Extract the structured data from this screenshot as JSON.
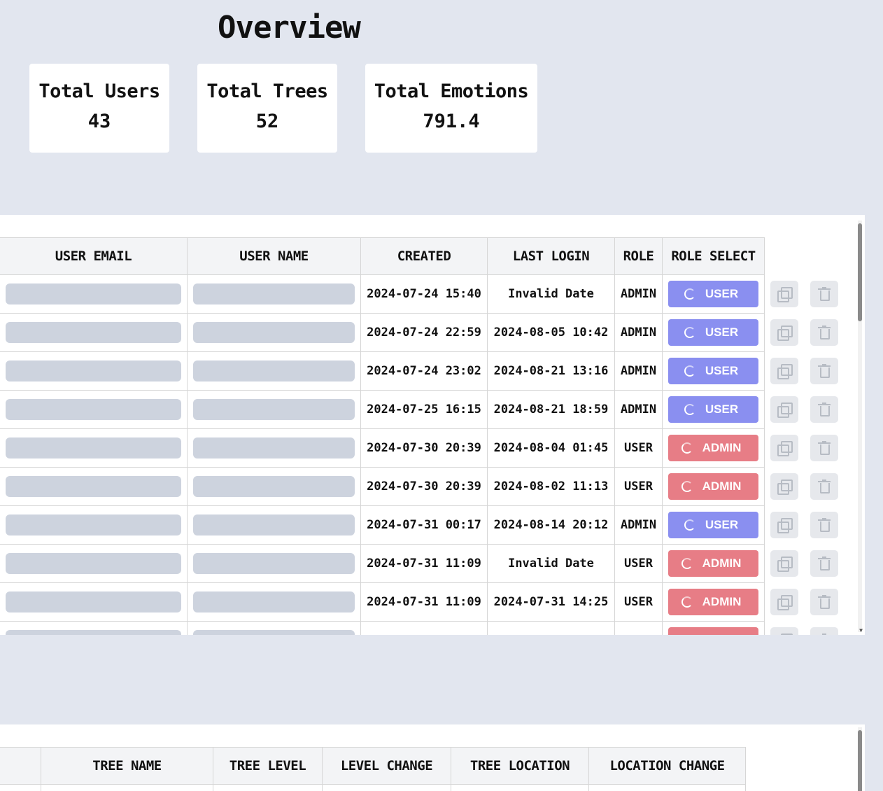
{
  "header": {
    "title": "Overview"
  },
  "stats": [
    {
      "label": "Total Users",
      "value": "43"
    },
    {
      "label": "Total Trees",
      "value": "52"
    },
    {
      "label": "Total Emotions",
      "value": "791.4"
    }
  ],
  "users_table": {
    "columns": [
      "USER EMAIL",
      "USER NAME",
      "CREATED",
      "LAST LOGIN",
      "ROLE",
      "ROLE SELECT"
    ],
    "rows": [
      {
        "created": "2024-07-24 15:40",
        "last_login": "Invalid Date",
        "role": "ADMIN",
        "role_select": "USER"
      },
      {
        "created": "2024-07-24 22:59",
        "last_login": "2024-08-05 10:42",
        "role": "ADMIN",
        "role_select": "USER"
      },
      {
        "created": "2024-07-24 23:02",
        "last_login": "2024-08-21 13:16",
        "role": "ADMIN",
        "role_select": "USER"
      },
      {
        "created": "2024-07-25 16:15",
        "last_login": "2024-08-21 18:59",
        "role": "ADMIN",
        "role_select": "USER"
      },
      {
        "created": "2024-07-30 20:39",
        "last_login": "2024-08-04 01:45",
        "role": "USER",
        "role_select": "ADMIN"
      },
      {
        "created": "2024-07-30 20:39",
        "last_login": "2024-08-02 11:13",
        "role": "USER",
        "role_select": "ADMIN"
      },
      {
        "created": "2024-07-31 00:17",
        "last_login": "2024-08-14 20:12",
        "role": "ADMIN",
        "role_select": "USER"
      },
      {
        "created": "2024-07-31 11:09",
        "last_login": "Invalid Date",
        "role": "USER",
        "role_select": "ADMIN"
      },
      {
        "created": "2024-07-31 11:09",
        "last_login": "2024-07-31 14:25",
        "role": "USER",
        "role_select": "ADMIN"
      },
      {
        "created": "",
        "last_login": "",
        "role": "",
        "role_select": ""
      }
    ]
  },
  "trees_table": {
    "columns": [
      "",
      "TREE NAME",
      "TREE LEVEL",
      "LEVEL CHANGE",
      "TREE LOCATION",
      "LOCATION CHANGE"
    ]
  },
  "colors": {
    "background": "#e2e6ef",
    "user_button": "#8a8ff0",
    "admin_button": "#e77d86",
    "level_change_pill": "#3fa34d",
    "location_change_pill": "#e0c36a"
  },
  "icons": [
    "refresh-icon",
    "copy-icon",
    "trash-icon"
  ]
}
